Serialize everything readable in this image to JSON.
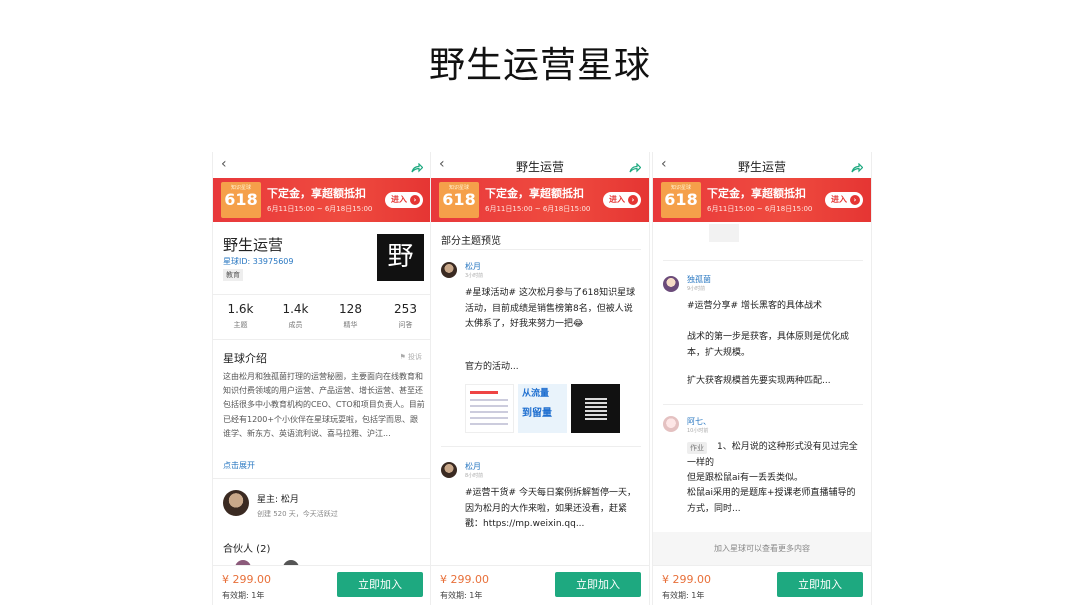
{
  "slide": {
    "title": "野生运营星球"
  },
  "banner": {
    "badge_small": "知识星球",
    "badge_big": "618",
    "headline": "下定金，享超额抵扣",
    "dates": "6月11日15:00 ~ 6月18日15:00",
    "enter": "进入"
  },
  "footer": {
    "price": "¥ 299.00",
    "validity": "有效期: 1年",
    "join": "立即加入"
  },
  "phone1": {
    "name": "野生运营",
    "planet_id": "星球ID: 33975609",
    "tag": "教育",
    "logo_char": "野",
    "stats": [
      {
        "num": "1.6k",
        "label": "主题"
      },
      {
        "num": "1.4k",
        "label": "成员"
      },
      {
        "num": "128",
        "label": "精华"
      },
      {
        "num": "253",
        "label": "问答"
      }
    ],
    "intro_title": "星球介绍",
    "report": "⚑ 投诉",
    "intro": "这由松月和独孤菌打理的运营秘圈，主要面向在线教育和知识付费领域的用户运营、产品运营、增长运营、甚至还包括很多中小教育机构的CEO、CTO和项目负责人。目前已经有1200+个小伙伴在星球玩耍啦，包括学而思、跟谁学、新东方、英语流利说、喜马拉雅、沪江...",
    "expand": "点击展开",
    "owner": "星主: 松月",
    "owner_meta": "创建 520 天，今天活跃过",
    "partners": "合伙人 (2)"
  },
  "phone2": {
    "nav_title": "野生运营",
    "preview_title": "部分主题预览",
    "post1": {
      "author": "松月",
      "time": "3小时前",
      "body": "#星球活动# 这次松月参与了618知识星球活动，目前成绩是销售榜第8名，但被人说太佛系了，好我来努力一把😂",
      "sub": "官方的活动..."
    },
    "thumb2": {
      "line1": "从流量",
      "line2": "到留量"
    },
    "post2": {
      "author": "松月",
      "time": "8小时前",
      "body": "#运营干货# 今天每日案例拆解暂停一天，因为松月的大作来啦，如果还没看，赶紧戳：https://mp.weixin.qq..."
    }
  },
  "phone3": {
    "nav_title": "野生运营",
    "post1": {
      "author": "独孤菌",
      "time": "9小时前",
      "body": "#运营分享# 增长黑客的具体战术",
      "p2": "战术的第一步是获客，具体原则是优化成本，扩大规模。",
      "p3": "扩大获客规模首先要实现两种匹配..."
    },
    "post2": {
      "author": "阿七、",
      "time": "10小时前",
      "tag": "作业",
      "body": "1、松月说的这种形式没有见过完全一样的",
      "l2": "但是跟松鼠ai有一丢丢类似。",
      "l3": "松鼠ai采用的是题库+授课老师直播辅导的方式，同时..."
    },
    "more": "加入星球可以查看更多内容"
  },
  "colors": {
    "accent": "#1ea980",
    "banner": "#e8383b",
    "price": "#e8703a",
    "link": "#2a78c2"
  },
  "icons": {
    "back": "chevron-left-icon",
    "share": "share-arrow-icon"
  }
}
